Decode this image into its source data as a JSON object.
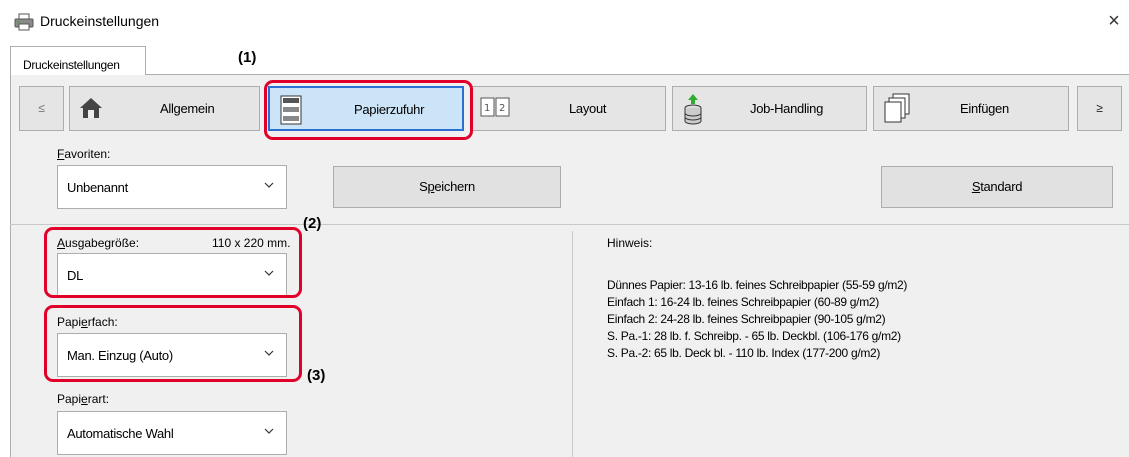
{
  "window": {
    "title": "Druckeinstellungen",
    "close_glyph": "×"
  },
  "tabs": [
    {
      "label": "Druckeinstellungen"
    }
  ],
  "callouts": {
    "c1": "(1)",
    "c2": "(2)",
    "c3": "(3)"
  },
  "nav": {
    "prev": "≤",
    "next": "≥",
    "buttons": [
      {
        "label": "Allgemein",
        "icon": "home-icon"
      },
      {
        "label": "Papierzufuhr",
        "icon": "paper-tray-icon",
        "selected": true
      },
      {
        "label": "Layout",
        "icon": "layout-icon"
      },
      {
        "label": "Job-Handling",
        "icon": "job-handling-icon"
      },
      {
        "label": "Einfügen",
        "icon": "insert-pages-icon"
      }
    ]
  },
  "favorites": {
    "label": "Favoriten:",
    "value": "Unbenannt",
    "save_button": "Speichern",
    "default_button": "Standard"
  },
  "output_size": {
    "label": "Ausgabegröße:",
    "dimensions": "110 x 220 mm.",
    "value": "DL"
  },
  "paper_tray": {
    "label": "Papierfach:",
    "value": "Man. Einzug (Auto)"
  },
  "paper_type": {
    "label": "Papierart:",
    "value": "Automatische Wahl"
  },
  "hint": {
    "label": "Hinweis:",
    "lines": [
      "Dünnes Papier: 13-16 lb. feines Schreibpapier (55-59 g/m2)",
      "Einfach 1: 16-24 lb. feines Schreibpapier (60-89 g/m2)",
      "Einfach 2: 24-28 lb. feines Schreibpapier (90-105 g/m2)",
      "S. Pa.-1: 28 lb. f. Schreibp. - 65 lb. Deckbl. (106-176 g/m2)",
      "S. Pa.-2: 65 lb. Deck bl. - 110 lb. Index (177-200 g/m2)"
    ]
  },
  "colors": {
    "highlight": "#e0002a",
    "selected_fill": "#cce4f7",
    "selected_border": "#2a6fd1"
  }
}
